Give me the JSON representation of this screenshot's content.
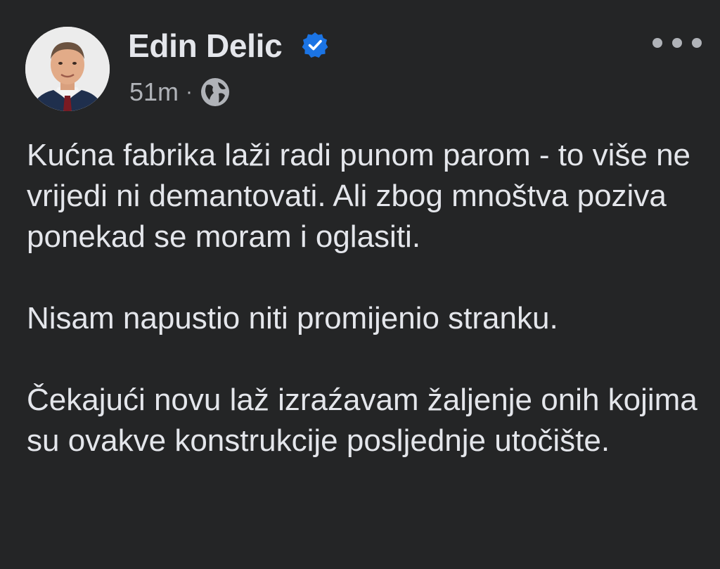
{
  "post": {
    "author": {
      "name": "Edin Delic",
      "verified_icon": "verified-badge-icon"
    },
    "timestamp": "51m",
    "separator": "·",
    "audience_icon": "globe-icon",
    "more_icon": "more-options-icon",
    "paragraphs": [
      "Kućna fabrika laži radi punom parom - to više ne vrijedi ni demantovati. Ali zbog mnoštva poziva ponekad se moram i oglasiti.",
      "Nisam napustio niti promijenio stranku.",
      "Čekajući novu laž izraźavam žaljenje onih kojima su ovakve konstrukcije posljednje utočište."
    ]
  },
  "colors": {
    "background": "#242526",
    "text_primary": "#e4e6eb",
    "text_secondary": "#b0b3b8",
    "verified_blue": "#1b74e4"
  }
}
